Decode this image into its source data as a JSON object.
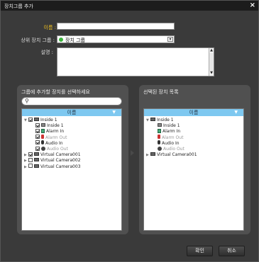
{
  "window": {
    "title": "장치그룹 추가",
    "close_icon": "close-icon"
  },
  "form": {
    "name_label": "이름 :",
    "name_value": "",
    "parent_label": "상위 장치 그룹 :",
    "parent_value": "장치 그룹",
    "desc_label": "설명 :",
    "desc_value": ""
  },
  "left_panel": {
    "title": "그룹에 추가할 장치를 선택하세요",
    "search_placeholder": "",
    "column_header": "이름",
    "rows": [
      {
        "label": "Inside 1",
        "level": 0,
        "expanded": true,
        "checked": true,
        "icon": "camera-icon",
        "dim": false
      },
      {
        "label": "Inside 1",
        "level": 1,
        "checked": true,
        "icon": "camera-channel-icon",
        "dim": false
      },
      {
        "label": "Alarm In",
        "level": 1,
        "checked": true,
        "icon": "alarm-in-icon",
        "dim": false
      },
      {
        "label": "Alarm Out",
        "level": 1,
        "checked": true,
        "icon": "alarm-out-icon",
        "dim": true
      },
      {
        "label": "Audio In",
        "level": 1,
        "checked": true,
        "icon": "audio-in-icon",
        "dim": false
      },
      {
        "label": "Audio Out",
        "level": 1,
        "checked": true,
        "icon": "audio-out-icon",
        "dim": true
      },
      {
        "label": "Virtual Camera001",
        "level": 0,
        "expanded": false,
        "checked": true,
        "icon": "camera-icon",
        "dim": false
      },
      {
        "label": "Virtual Camera002",
        "level": 0,
        "expanded": false,
        "checked": false,
        "icon": "camera-icon",
        "dim": false
      },
      {
        "label": "Virtual Camera003",
        "level": 0,
        "expanded": false,
        "checked": false,
        "icon": "camera-icon",
        "dim": false
      }
    ]
  },
  "right_panel": {
    "title": "선택된 장치 목록",
    "column_header": "이름",
    "rows": [
      {
        "label": "Inside 1",
        "level": 0,
        "expanded": true,
        "icon": "camera-icon",
        "dim": false
      },
      {
        "label": "Inside 1",
        "level": 1,
        "icon": "camera-channel-icon",
        "dim": false
      },
      {
        "label": "Alarm In",
        "level": 1,
        "icon": "alarm-in-icon",
        "dim": false
      },
      {
        "label": "Alarm Out",
        "level": 1,
        "icon": "alarm-out-icon",
        "dim": true
      },
      {
        "label": "Audio In",
        "level": 1,
        "icon": "audio-in-icon",
        "dim": false
      },
      {
        "label": "Audio Out",
        "level": 1,
        "icon": "audio-out-icon",
        "dim": true
      },
      {
        "label": "Virtual Camera001",
        "level": 0,
        "expanded": false,
        "icon": "camera-icon",
        "dim": false
      }
    ]
  },
  "buttons": {
    "ok_label": "확인",
    "cancel_label": "취소"
  },
  "colors": {
    "header_blue": "#7ec8f0",
    "required_label": "#f0c020",
    "group_dot": "#3bb33b"
  }
}
